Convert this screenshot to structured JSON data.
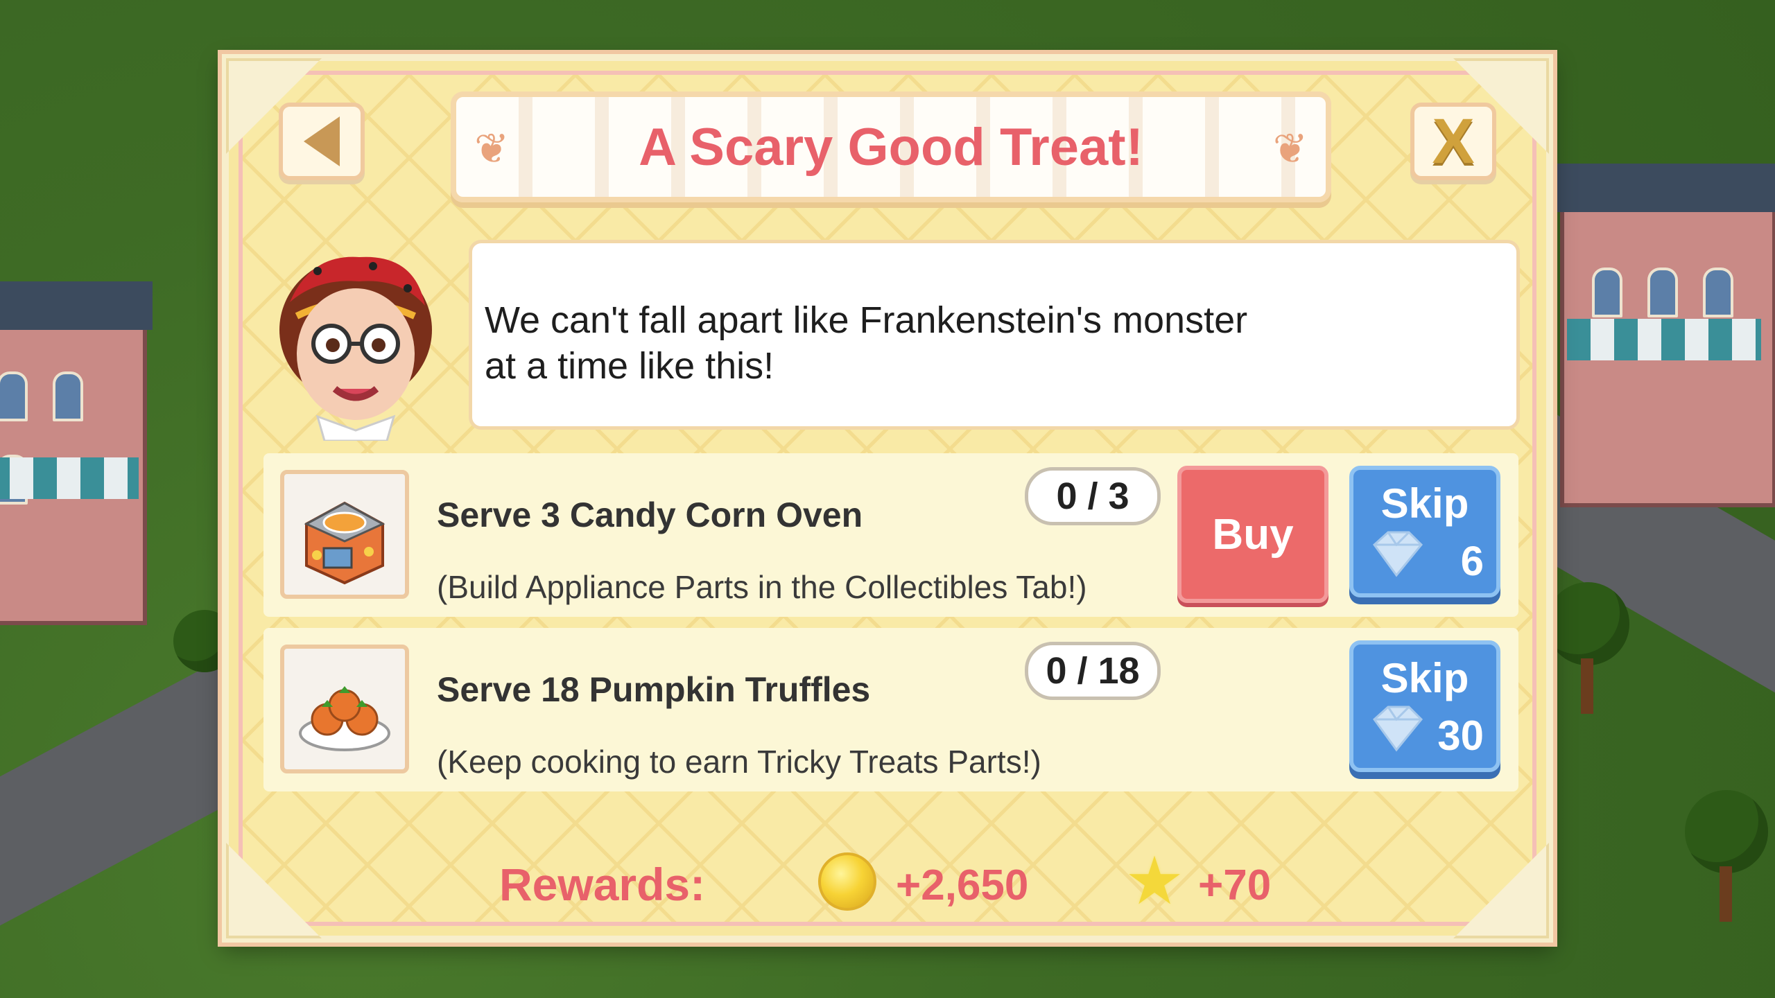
{
  "dialog": {
    "title": "A Scary Good Treat!",
    "back_icon": "back-arrow-icon",
    "close_label": "X",
    "speech_lines": [
      "We can't fall apart like Frankenstein's monster",
      "at a time like this!"
    ]
  },
  "tasks": [
    {
      "title": "Serve 3 Candy Corn Oven",
      "hint": "(Build Appliance Parts in the Collectibles Tab!)",
      "progress": "0 / 3",
      "buy_label": "Buy",
      "skip_label": "Skip",
      "skip_cost": "6",
      "icon": "candy-corn-oven-icon"
    },
    {
      "title": "Serve 18 Pumpkin Truffles",
      "hint": "(Keep cooking to earn Tricky Treats Parts!)",
      "progress": "0 / 18",
      "skip_label": "Skip",
      "skip_cost": "30",
      "icon": "pumpkin-truffles-icon"
    }
  ],
  "rewards": {
    "label": "Rewards:",
    "coins": "+2,650",
    "xp": "+70"
  },
  "colors": {
    "title": "#e8616a",
    "buy": "#ec6a6a",
    "skip": "#4f93e0",
    "panel": "#f9eaa6"
  }
}
